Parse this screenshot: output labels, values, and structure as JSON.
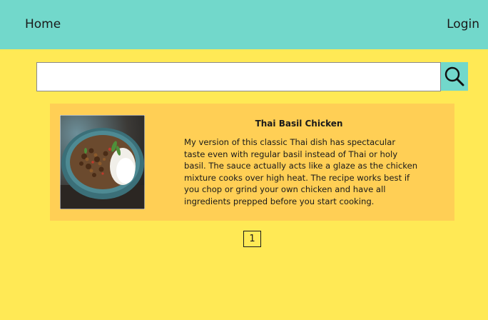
{
  "navbar": {
    "home_label": "Home",
    "login_label": "Login",
    "background": "#72D8CB"
  },
  "search": {
    "placeholder": "",
    "value": "",
    "button_icon": "search-icon"
  },
  "results": [
    {
      "title": "Thai Basil Chicken",
      "description": "My version of this classic Thai dish has spectacular taste even with regular basil instead of Thai or holy basil. The sauce actually acts like a glaze as the chicken mixture cooks over high heat. The recipe works best if you chop or grind your own chicken and have all ingredients prepped before you start cooking.",
      "image": "bowl of thai basil chicken with rice"
    }
  ],
  "pagination": {
    "current_page": "1"
  },
  "colors": {
    "page_background": "#FFE955",
    "card_background": "#FFCF55",
    "accent": "#72D8CB"
  }
}
